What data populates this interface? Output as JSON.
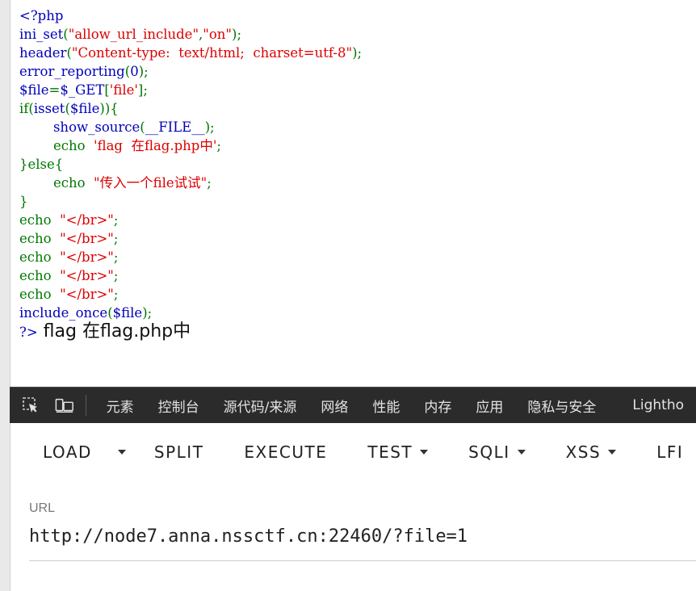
{
  "source_code": {
    "l1": "<?php",
    "l2_fn": "ini_set",
    "l2_p1": "(",
    "l2_s1": "\"allow_url_include\"",
    "l2_p2": ",",
    "l2_s2": "\"on\"",
    "l2_p3": ");",
    "l3_fn": "header",
    "l3_p1": "(",
    "l3_s1": "\"Content-type:  text/html;  charset=utf-8\"",
    "l3_p2": ");",
    "l4_fn": "error_reporting",
    "l4_p1": "(",
    "l4_n": "0",
    "l4_p2": ");",
    "l5_var": "$file",
    "l5_op": "=",
    "l5_get": "$_GET",
    "l5_p1": "[",
    "l5_s": "'file'",
    "l5_p2": "];",
    "l6_kw": "if(",
    "l6_fn": "isset",
    "l6_p1": "(",
    "l6_var": "$file",
    "l6_p2": ")){",
    "l7_indent": "        ",
    "l7_fn": "show_source",
    "l7_p1": "(",
    "l7_const": "__FILE__",
    "l7_p2": ");",
    "l8_indent": "        ",
    "l8_kw": "echo  ",
    "l8_s": "'flag  在flag.php中'",
    "l8_p": ";",
    "l9": "}else{",
    "l10_indent": "        ",
    "l10_kw": "echo  ",
    "l10_s": "\"传入一个file试试\"",
    "l10_p": ";",
    "l11": "}",
    "echo_kw": "echo  ",
    "echo_s": "\"</br>\"",
    "echo_p": ";",
    "l17_fn": "include_once",
    "l17_p1": "(",
    "l17_var": "$file",
    "l17_p2": ");",
    "close_tag": "?>",
    "output_text": " flag 在flag.php中"
  },
  "devtools": {
    "tabs": [
      "元素",
      "控制台",
      "源代码/来源",
      "网络",
      "性能",
      "内存",
      "应用",
      "隐私与安全",
      "Lightho"
    ]
  },
  "hackbar": {
    "load": "LOAD",
    "split": "SPLIT",
    "execute": "EXECUTE",
    "test": "TEST",
    "sqli": "SQLI",
    "xss": "XSS",
    "lfi": "LFI"
  },
  "url_field": {
    "label": "URL",
    "value": "http://node7.anna.nssctf.cn:22460/?file=1"
  }
}
